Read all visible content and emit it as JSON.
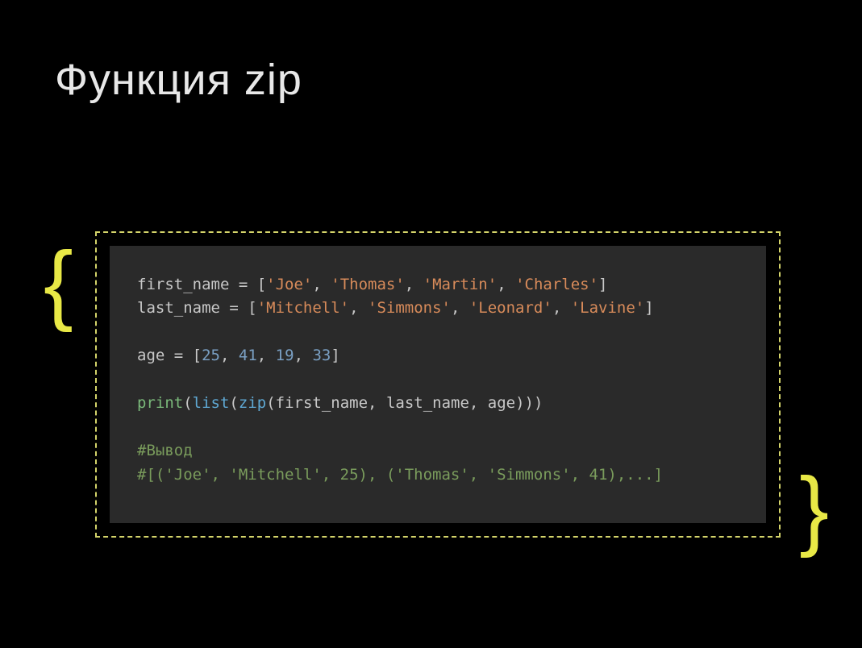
{
  "title": "Функция zip",
  "brace_left": "{",
  "brace_right": "}",
  "code": {
    "line1": {
      "var": "first_name",
      "eq": " = ",
      "lb": "[",
      "s1": "'Joe'",
      "c1": ", ",
      "s2": "'Thomas'",
      "c2": ", ",
      "s3": "'Martin'",
      "c3": ", ",
      "s4": "'Charles'",
      "rb": "]"
    },
    "line2": {
      "var": "last_name",
      "eq": " = ",
      "lb": "[",
      "s1": "'Mitchell'",
      "c1": ", ",
      "s2": "'Simmons'",
      "c2": ", ",
      "s3": "'Leonard'",
      "c3": ", ",
      "s4": "'Lavine'",
      "rb": "]"
    },
    "line3": {
      "var": "age",
      "eq": " = ",
      "lb": "[",
      "n1": "25",
      "c1": ", ",
      "n2": "41",
      "c2": ", ",
      "n3": "19",
      "c3": ", ",
      "n4": "33",
      "rb": "]"
    },
    "line4": {
      "print": "print",
      "lp1": "(",
      "list": "list",
      "lp2": "(",
      "zip": "zip",
      "lp3": "(",
      "a1": "first_name",
      "c1": ", ",
      "a2": "last_name",
      "c2": ", ",
      "a3": "age",
      "rp": ")))"
    },
    "comment1": "#Вывод",
    "comment2": "#[('Joe', 'Mitchell', 25), ('Thomas', 'Simmons', 41),...]"
  }
}
